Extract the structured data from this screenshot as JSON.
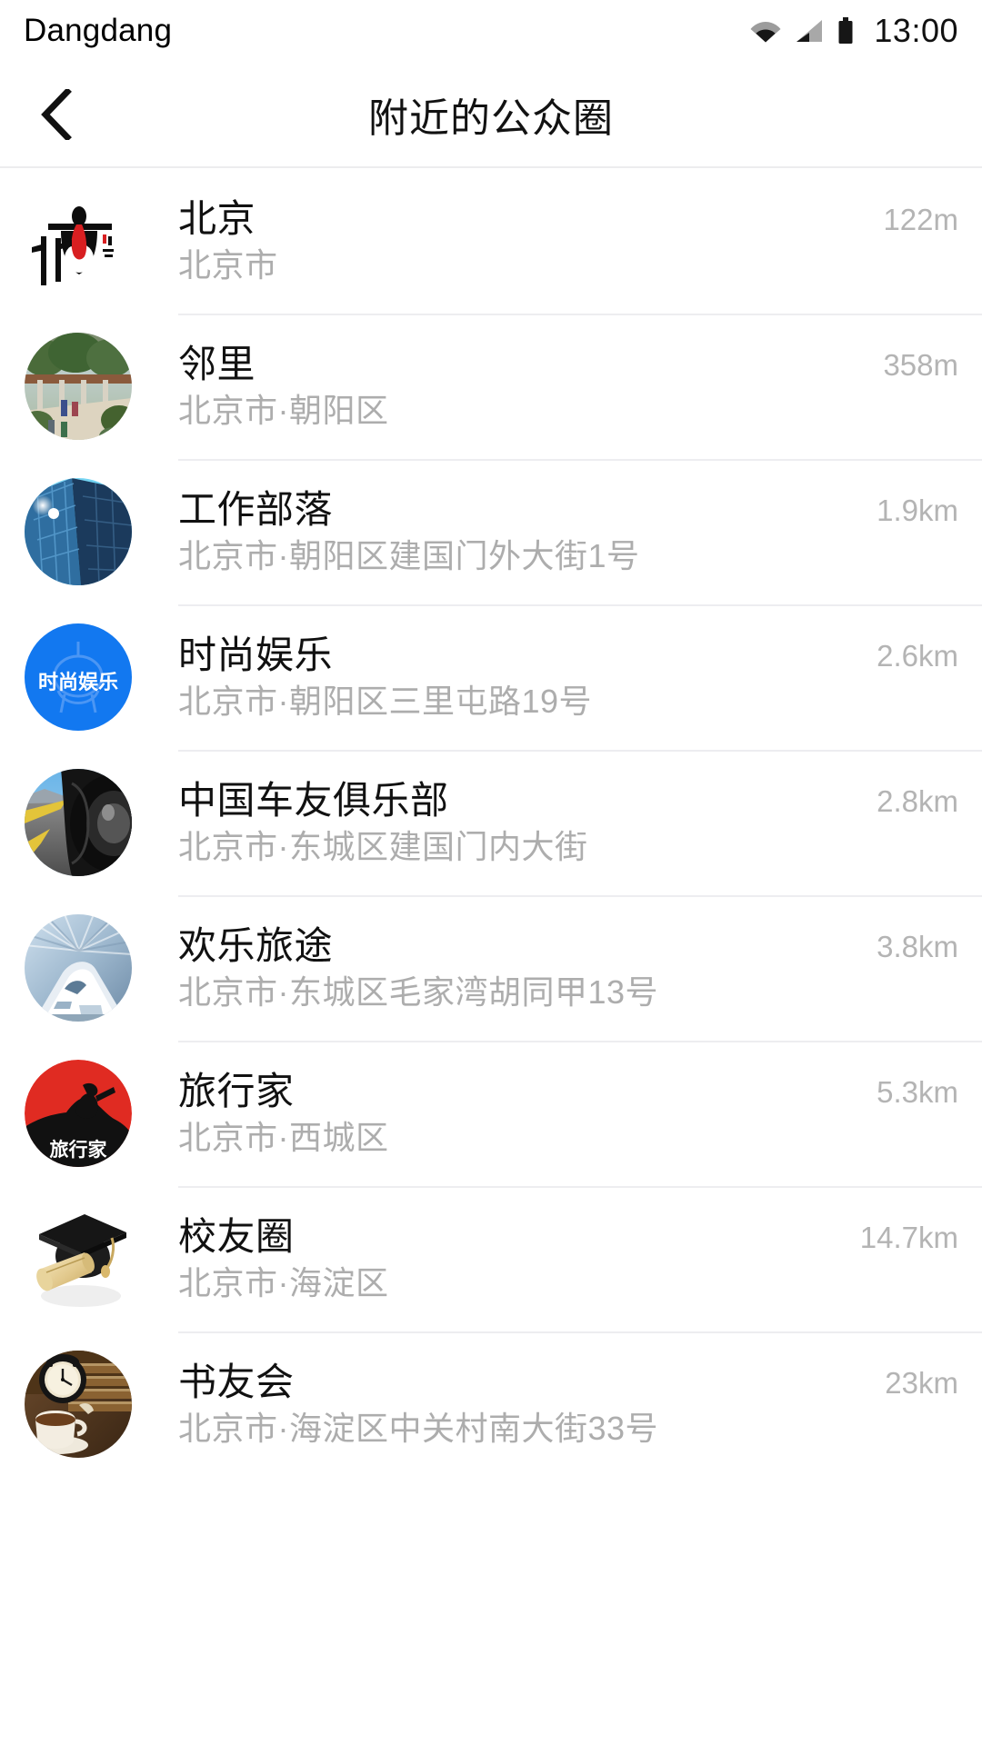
{
  "status_bar": {
    "carrier": "Dangdang",
    "time": "13:00",
    "icons": [
      "wifi-icon",
      "signal-icon",
      "battery-icon"
    ]
  },
  "header": {
    "back_icon": "chevron-left-icon",
    "title": "附近的公众圈"
  },
  "colors": {
    "text_primary": "#111111",
    "text_secondary": "#adadad",
    "distance": "#b4b4b4",
    "divider": "#ededf0",
    "accent_blue": "#1278f0",
    "accent_red": "#d81f21",
    "background": "#ffffff"
  },
  "list": {
    "items": [
      {
        "name": "北京",
        "address": "北京市",
        "distance": "122m",
        "avatar": "beijing-olympic-logo-avatar",
        "avatar_shape": "square"
      },
      {
        "name": "邻里",
        "address": "北京市·朝阳区",
        "distance": "358m",
        "avatar": "neighborhood-park-photo-avatar",
        "avatar_shape": "circle"
      },
      {
        "name": "工作部落",
        "address": "北京市·朝阳区建国门外大街1号",
        "distance": "1.9km",
        "avatar": "glass-office-tower-photo-avatar",
        "avatar_shape": "circle"
      },
      {
        "name": "时尚娱乐",
        "address": "北京市·朝阳区三里屯路19号",
        "distance": "2.6km",
        "avatar": "fashion-entertainment-blue-logo-avatar",
        "avatar_shape": "circle",
        "avatar_text": "时尚娱乐"
      },
      {
        "name": "中国车友俱乐部",
        "address": "北京市·东城区建国门内大街",
        "distance": "2.8km",
        "avatar": "car-tire-road-photo-avatar",
        "avatar_shape": "circle"
      },
      {
        "name": "欢乐旅途",
        "address": "北京市·东城区毛家湾胡同甲13号",
        "distance": "3.8km",
        "avatar": "high-speed-train-photo-avatar",
        "avatar_shape": "circle"
      },
      {
        "name": "旅行家",
        "address": "北京市·西城区",
        "distance": "5.3km",
        "avatar": "traveler-red-sun-logo-avatar",
        "avatar_shape": "circle",
        "avatar_text": "旅行家"
      },
      {
        "name": "校友圈",
        "address": "北京市·海淀区",
        "distance": "14.7km",
        "avatar": "graduation-cap-diploma-avatar",
        "avatar_shape": "square"
      },
      {
        "name": "书友会",
        "address": "北京市·海淀区中关村南大街33号",
        "distance": "23km",
        "avatar": "vintage-clock-coffee-books-photo-avatar",
        "avatar_shape": "circle"
      }
    ]
  }
}
